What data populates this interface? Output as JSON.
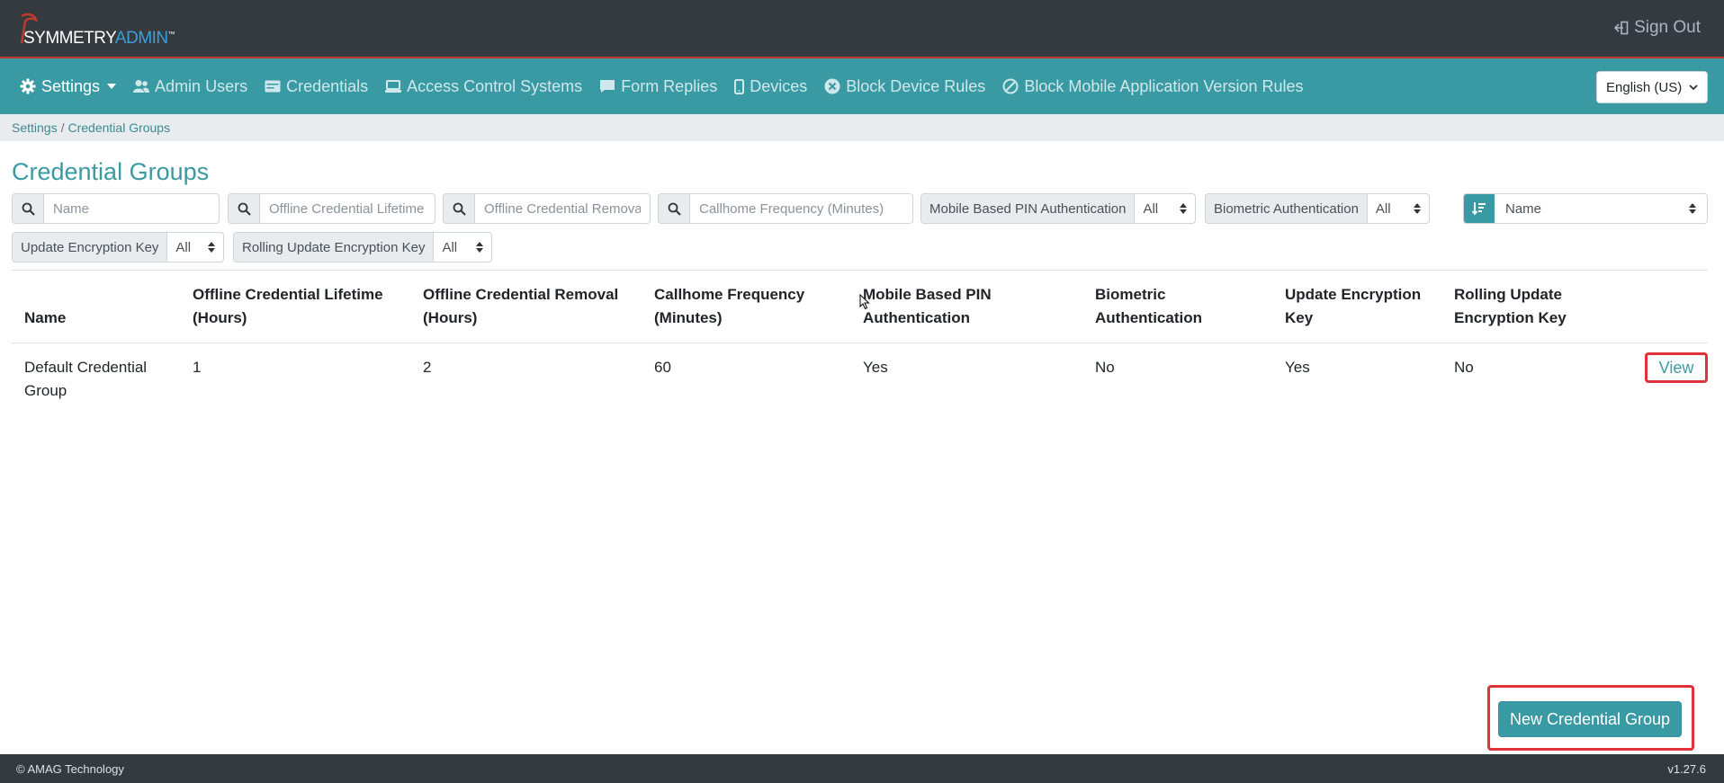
{
  "header": {
    "logo_text_main": "SYMMETRY",
    "logo_text_accent": "ADMIN",
    "logo_trademark": "™",
    "signout_label": "Sign Out"
  },
  "nav": {
    "items": [
      {
        "label": "Settings",
        "icon": "gear-icon",
        "active": true,
        "dropdown": true
      },
      {
        "label": "Admin Users",
        "icon": "users-icon"
      },
      {
        "label": "Credentials",
        "icon": "id-card-icon"
      },
      {
        "label": "Access Control Systems",
        "icon": "access-control-icon"
      },
      {
        "label": "Form Replies",
        "icon": "comment-icon"
      },
      {
        "label": "Devices",
        "icon": "mobile-icon"
      },
      {
        "label": "Block Device Rules",
        "icon": "times-circle-icon"
      },
      {
        "label": "Block Mobile Application Version Rules",
        "icon": "ban-icon"
      }
    ],
    "language": "English (US)"
  },
  "breadcrumb": {
    "parent": "Settings",
    "separator": "/",
    "current": "Credential Groups"
  },
  "page": {
    "title": "Credential Groups"
  },
  "filters": {
    "name_placeholder": "Name",
    "lifetime_placeholder": "Offline Credential Lifetime (Hours)",
    "removal_placeholder": "Offline Credential Removal (Hours)",
    "callhome_placeholder": "Callhome Frequency (Minutes)",
    "mobile_pin_label": "Mobile Based PIN Authentication",
    "mobile_pin_value": "All",
    "biometric_label": "Biometric Authentication",
    "biometric_value": "All",
    "update_key_label": "Update Encryption Key",
    "update_key_value": "All",
    "rolling_key_label": "Rolling Update Encryption Key",
    "rolling_key_value": "All",
    "sort_value": "Name"
  },
  "table": {
    "headers": [
      "Name",
      "Offline Credential Lifetime (Hours)",
      "Offline Credential Removal (Hours)",
      "Callhome Frequency (Minutes)",
      "Mobile Based PIN Authentication",
      "Biometric Authentication",
      "Update Encryption Key",
      "Rolling Update Encryption Key"
    ],
    "rows": [
      {
        "name": "Default Credential Group",
        "lifetime": "1",
        "removal": "2",
        "callhome": "60",
        "mobile_pin": "Yes",
        "biometric": "No",
        "update_key": "Yes",
        "rolling_key": "No",
        "action": "View"
      }
    ]
  },
  "actions": {
    "new_label": "New Credential Group"
  },
  "footer": {
    "copyright": "© AMAG Technology",
    "version": "v1.27.6"
  },
  "colors": {
    "primary": "#3a9aa3",
    "topbar": "#343a40",
    "highlight_border": "#e0323a"
  }
}
